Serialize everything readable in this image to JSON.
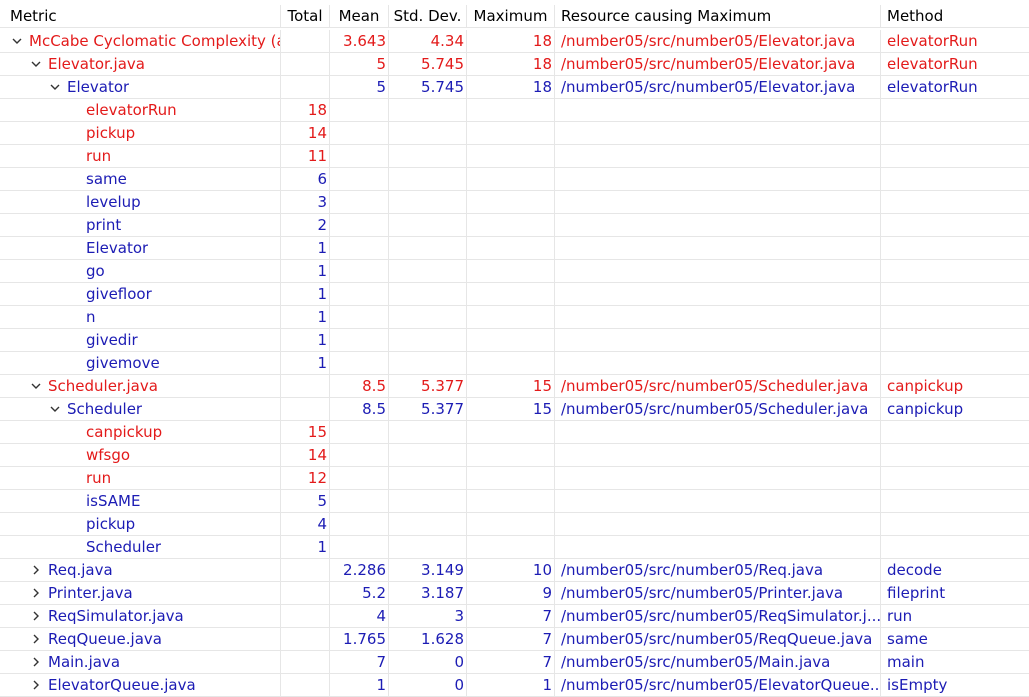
{
  "columns": {
    "metric": "Metric",
    "total": "Total",
    "mean": "Mean",
    "std": "Std. Dev.",
    "max": "Maximum",
    "resource": "Resource causing Maximum",
    "method": "Method"
  },
  "colors": {
    "red": "#e31a1a",
    "blue": "#1c1cb4"
  },
  "rows": [
    {
      "level": 0,
      "toggle": "expanded",
      "color": "red",
      "metric": "McCabe Cyclomatic Complexity (av",
      "total": "",
      "mean": "3.643",
      "std": "4.34",
      "max": "18",
      "resource": "/number05/src/number05/Elevator.java",
      "method": "elevatorRun"
    },
    {
      "level": 1,
      "toggle": "expanded",
      "color": "red",
      "metric": "Elevator.java",
      "total": "",
      "mean": "5",
      "std": "5.745",
      "max": "18",
      "resource": "/number05/src/number05/Elevator.java",
      "method": "elevatorRun"
    },
    {
      "level": 2,
      "toggle": "expanded",
      "color": "blue",
      "metric": "Elevator",
      "total": "",
      "mean": "5",
      "std": "5.745",
      "max": "18",
      "resource": "/number05/src/number05/Elevator.java",
      "method": "elevatorRun"
    },
    {
      "level": 3,
      "toggle": "none",
      "color": "red",
      "metric": "elevatorRun",
      "total": "18",
      "mean": "",
      "std": "",
      "max": "",
      "resource": "",
      "method": ""
    },
    {
      "level": 3,
      "toggle": "none",
      "color": "red",
      "metric": "pickup",
      "total": "14",
      "mean": "",
      "std": "",
      "max": "",
      "resource": "",
      "method": ""
    },
    {
      "level": 3,
      "toggle": "none",
      "color": "red",
      "metric": "run",
      "total": "11",
      "mean": "",
      "std": "",
      "max": "",
      "resource": "",
      "method": ""
    },
    {
      "level": 3,
      "toggle": "none",
      "color": "blue",
      "metric": "same",
      "total": "6",
      "mean": "",
      "std": "",
      "max": "",
      "resource": "",
      "method": ""
    },
    {
      "level": 3,
      "toggle": "none",
      "color": "blue",
      "metric": "levelup",
      "total": "3",
      "mean": "",
      "std": "",
      "max": "",
      "resource": "",
      "method": ""
    },
    {
      "level": 3,
      "toggle": "none",
      "color": "blue",
      "metric": "print",
      "total": "2",
      "mean": "",
      "std": "",
      "max": "",
      "resource": "",
      "method": ""
    },
    {
      "level": 3,
      "toggle": "none",
      "color": "blue",
      "metric": "Elevator",
      "total": "1",
      "mean": "",
      "std": "",
      "max": "",
      "resource": "",
      "method": ""
    },
    {
      "level": 3,
      "toggle": "none",
      "color": "blue",
      "metric": "go",
      "total": "1",
      "mean": "",
      "std": "",
      "max": "",
      "resource": "",
      "method": ""
    },
    {
      "level": 3,
      "toggle": "none",
      "color": "blue",
      "metric": "givefloor",
      "total": "1",
      "mean": "",
      "std": "",
      "max": "",
      "resource": "",
      "method": ""
    },
    {
      "level": 3,
      "toggle": "none",
      "color": "blue",
      "metric": "n",
      "total": "1",
      "mean": "",
      "std": "",
      "max": "",
      "resource": "",
      "method": ""
    },
    {
      "level": 3,
      "toggle": "none",
      "color": "blue",
      "metric": "givedir",
      "total": "1",
      "mean": "",
      "std": "",
      "max": "",
      "resource": "",
      "method": ""
    },
    {
      "level": 3,
      "toggle": "none",
      "color": "blue",
      "metric": "givemove",
      "total": "1",
      "mean": "",
      "std": "",
      "max": "",
      "resource": "",
      "method": ""
    },
    {
      "level": 1,
      "toggle": "expanded",
      "color": "red",
      "metric": "Scheduler.java",
      "total": "",
      "mean": "8.5",
      "std": "5.377",
      "max": "15",
      "resource": "/number05/src/number05/Scheduler.java",
      "method": "canpickup"
    },
    {
      "level": 2,
      "toggle": "expanded",
      "color": "blue",
      "metric": "Scheduler",
      "total": "",
      "mean": "8.5",
      "std": "5.377",
      "max": "15",
      "resource": "/number05/src/number05/Scheduler.java",
      "method": "canpickup"
    },
    {
      "level": 3,
      "toggle": "none",
      "color": "red",
      "metric": "canpickup",
      "total": "15",
      "mean": "",
      "std": "",
      "max": "",
      "resource": "",
      "method": ""
    },
    {
      "level": 3,
      "toggle": "none",
      "color": "red",
      "metric": "wfsgo",
      "total": "14",
      "mean": "",
      "std": "",
      "max": "",
      "resource": "",
      "method": ""
    },
    {
      "level": 3,
      "toggle": "none",
      "color": "red",
      "metric": "run",
      "total": "12",
      "mean": "",
      "std": "",
      "max": "",
      "resource": "",
      "method": ""
    },
    {
      "level": 3,
      "toggle": "none",
      "color": "blue",
      "metric": "isSAME",
      "total": "5",
      "mean": "",
      "std": "",
      "max": "",
      "resource": "",
      "method": ""
    },
    {
      "level": 3,
      "toggle": "none",
      "color": "blue",
      "metric": "pickup",
      "total": "4",
      "mean": "",
      "std": "",
      "max": "",
      "resource": "",
      "method": ""
    },
    {
      "level": 3,
      "toggle": "none",
      "color": "blue",
      "metric": "Scheduler",
      "total": "1",
      "mean": "",
      "std": "",
      "max": "",
      "resource": "",
      "method": ""
    },
    {
      "level": 1,
      "toggle": "collapsed",
      "color": "blue",
      "metric": "Req.java",
      "total": "",
      "mean": "2.286",
      "std": "3.149",
      "max": "10",
      "resource": "/number05/src/number05/Req.java",
      "method": "decode"
    },
    {
      "level": 1,
      "toggle": "collapsed",
      "color": "blue",
      "metric": "Printer.java",
      "total": "",
      "mean": "5.2",
      "std": "3.187",
      "max": "9",
      "resource": "/number05/src/number05/Printer.java",
      "method": "fileprint"
    },
    {
      "level": 1,
      "toggle": "collapsed",
      "color": "blue",
      "metric": "ReqSimulator.java",
      "total": "",
      "mean": "4",
      "std": "3",
      "max": "7",
      "resource": "/number05/src/number05/ReqSimulator.j...",
      "method": "run"
    },
    {
      "level": 1,
      "toggle": "collapsed",
      "color": "blue",
      "metric": "ReqQueue.java",
      "total": "",
      "mean": "1.765",
      "std": "1.628",
      "max": "7",
      "resource": "/number05/src/number05/ReqQueue.java",
      "method": "same"
    },
    {
      "level": 1,
      "toggle": "collapsed",
      "color": "blue",
      "metric": "Main.java",
      "total": "",
      "mean": "7",
      "std": "0",
      "max": "7",
      "resource": "/number05/src/number05/Main.java",
      "method": "main"
    },
    {
      "level": 1,
      "toggle": "collapsed",
      "color": "blue",
      "metric": "ElevatorQueue.java",
      "total": "",
      "mean": "1",
      "std": "0",
      "max": "1",
      "resource": "/number05/src/number05/ElevatorQueue....",
      "method": "isEmpty"
    }
  ]
}
